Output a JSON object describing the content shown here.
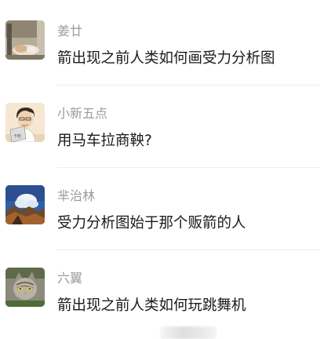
{
  "comments": [
    {
      "username": "姜廿",
      "text": "箭出现之前人类如何画受力分析图",
      "avatar": "cat-sleeping-avatar"
    },
    {
      "username": "小新五点",
      "text": "用马车拉商鞅?",
      "avatar": "cartoon-man-laptop-avatar"
    },
    {
      "username": "芈治林",
      "text": "受力分析图始于那个贩箭的人",
      "avatar": "sky-mountain-avatar"
    },
    {
      "username": "六翼",
      "text": "箭出现之前人类如何玩跳舞机",
      "avatar": "tabby-cat-avatar"
    }
  ]
}
